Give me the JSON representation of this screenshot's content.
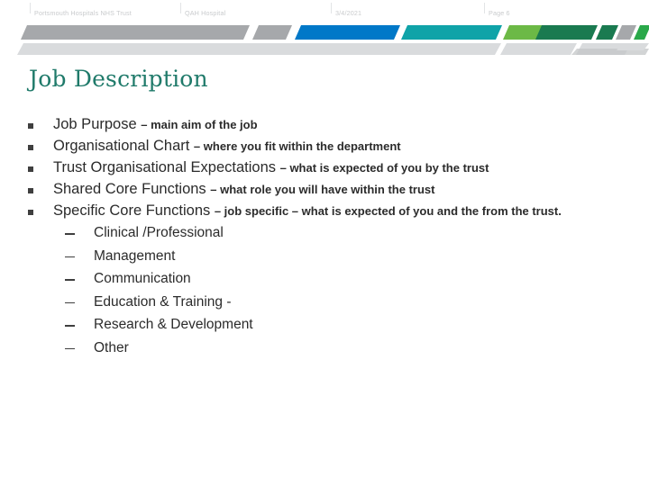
{
  "header": {
    "trust": "Portsmouth Hospitals NHS Trust",
    "site": "QAH Hospital",
    "date": "3/4/2021",
    "page": "Page 6"
  },
  "title": "Job Description",
  "colors": {
    "title": "#1f7a6a",
    "ribbon_gray": "#a6a8ab",
    "ribbon_blue": "#0078c8",
    "ribbon_teal": "#0fa3a8",
    "ribbon_green": "#6cb946",
    "ribbon_dark_green": "#1a7a50",
    "ribbon_pale": "#d7d9db",
    "body_text": "#2b2b2b"
  },
  "bullets": [
    {
      "lead": "Job Purpose ",
      "dash": "– ",
      "detail": "main aim of the job"
    },
    {
      "lead": "Organisational Chart ",
      "dash": "– ",
      "detail": "where you fit within the department"
    },
    {
      "lead": "Trust Organisational Expectations ",
      "dash": "– ",
      "detail": "what is expected of you by the trust"
    },
    {
      "lead": "Shared Core Functions ",
      "dash": "– ",
      "detail": "what role you will have within the trust"
    },
    {
      "lead": "Specific Core Functions ",
      "dash": "– ",
      "detail": "job specific – what is expected of you and the from the trust."
    }
  ],
  "sub_bullets": [
    "Clinical /Professional",
    "Management",
    "Communication",
    "Education & Training -",
    "Research & Development",
    "Other"
  ]
}
